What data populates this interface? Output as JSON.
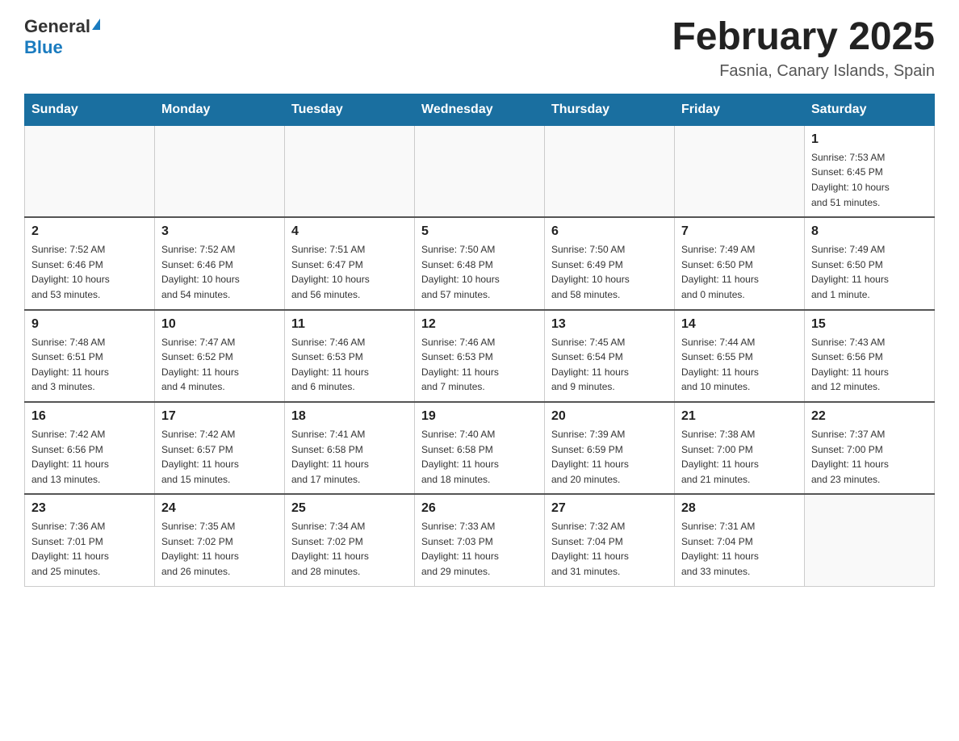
{
  "header": {
    "logo_general": "General",
    "logo_blue": "Blue",
    "title": "February 2025",
    "location": "Fasnia, Canary Islands, Spain"
  },
  "weekdays": [
    "Sunday",
    "Monday",
    "Tuesday",
    "Wednesday",
    "Thursday",
    "Friday",
    "Saturday"
  ],
  "weeks": [
    [
      {
        "day": "",
        "info": ""
      },
      {
        "day": "",
        "info": ""
      },
      {
        "day": "",
        "info": ""
      },
      {
        "day": "",
        "info": ""
      },
      {
        "day": "",
        "info": ""
      },
      {
        "day": "",
        "info": ""
      },
      {
        "day": "1",
        "info": "Sunrise: 7:53 AM\nSunset: 6:45 PM\nDaylight: 10 hours\nand 51 minutes."
      }
    ],
    [
      {
        "day": "2",
        "info": "Sunrise: 7:52 AM\nSunset: 6:46 PM\nDaylight: 10 hours\nand 53 minutes."
      },
      {
        "day": "3",
        "info": "Sunrise: 7:52 AM\nSunset: 6:46 PM\nDaylight: 10 hours\nand 54 minutes."
      },
      {
        "day": "4",
        "info": "Sunrise: 7:51 AM\nSunset: 6:47 PM\nDaylight: 10 hours\nand 56 minutes."
      },
      {
        "day": "5",
        "info": "Sunrise: 7:50 AM\nSunset: 6:48 PM\nDaylight: 10 hours\nand 57 minutes."
      },
      {
        "day": "6",
        "info": "Sunrise: 7:50 AM\nSunset: 6:49 PM\nDaylight: 10 hours\nand 58 minutes."
      },
      {
        "day": "7",
        "info": "Sunrise: 7:49 AM\nSunset: 6:50 PM\nDaylight: 11 hours\nand 0 minutes."
      },
      {
        "day": "8",
        "info": "Sunrise: 7:49 AM\nSunset: 6:50 PM\nDaylight: 11 hours\nand 1 minute."
      }
    ],
    [
      {
        "day": "9",
        "info": "Sunrise: 7:48 AM\nSunset: 6:51 PM\nDaylight: 11 hours\nand 3 minutes."
      },
      {
        "day": "10",
        "info": "Sunrise: 7:47 AM\nSunset: 6:52 PM\nDaylight: 11 hours\nand 4 minutes."
      },
      {
        "day": "11",
        "info": "Sunrise: 7:46 AM\nSunset: 6:53 PM\nDaylight: 11 hours\nand 6 minutes."
      },
      {
        "day": "12",
        "info": "Sunrise: 7:46 AM\nSunset: 6:53 PM\nDaylight: 11 hours\nand 7 minutes."
      },
      {
        "day": "13",
        "info": "Sunrise: 7:45 AM\nSunset: 6:54 PM\nDaylight: 11 hours\nand 9 minutes."
      },
      {
        "day": "14",
        "info": "Sunrise: 7:44 AM\nSunset: 6:55 PM\nDaylight: 11 hours\nand 10 minutes."
      },
      {
        "day": "15",
        "info": "Sunrise: 7:43 AM\nSunset: 6:56 PM\nDaylight: 11 hours\nand 12 minutes."
      }
    ],
    [
      {
        "day": "16",
        "info": "Sunrise: 7:42 AM\nSunset: 6:56 PM\nDaylight: 11 hours\nand 13 minutes."
      },
      {
        "day": "17",
        "info": "Sunrise: 7:42 AM\nSunset: 6:57 PM\nDaylight: 11 hours\nand 15 minutes."
      },
      {
        "day": "18",
        "info": "Sunrise: 7:41 AM\nSunset: 6:58 PM\nDaylight: 11 hours\nand 17 minutes."
      },
      {
        "day": "19",
        "info": "Sunrise: 7:40 AM\nSunset: 6:58 PM\nDaylight: 11 hours\nand 18 minutes."
      },
      {
        "day": "20",
        "info": "Sunrise: 7:39 AM\nSunset: 6:59 PM\nDaylight: 11 hours\nand 20 minutes."
      },
      {
        "day": "21",
        "info": "Sunrise: 7:38 AM\nSunset: 7:00 PM\nDaylight: 11 hours\nand 21 minutes."
      },
      {
        "day": "22",
        "info": "Sunrise: 7:37 AM\nSunset: 7:00 PM\nDaylight: 11 hours\nand 23 minutes."
      }
    ],
    [
      {
        "day": "23",
        "info": "Sunrise: 7:36 AM\nSunset: 7:01 PM\nDaylight: 11 hours\nand 25 minutes."
      },
      {
        "day": "24",
        "info": "Sunrise: 7:35 AM\nSunset: 7:02 PM\nDaylight: 11 hours\nand 26 minutes."
      },
      {
        "day": "25",
        "info": "Sunrise: 7:34 AM\nSunset: 7:02 PM\nDaylight: 11 hours\nand 28 minutes."
      },
      {
        "day": "26",
        "info": "Sunrise: 7:33 AM\nSunset: 7:03 PM\nDaylight: 11 hours\nand 29 minutes."
      },
      {
        "day": "27",
        "info": "Sunrise: 7:32 AM\nSunset: 7:04 PM\nDaylight: 11 hours\nand 31 minutes."
      },
      {
        "day": "28",
        "info": "Sunrise: 7:31 AM\nSunset: 7:04 PM\nDaylight: 11 hours\nand 33 minutes."
      },
      {
        "day": "",
        "info": ""
      }
    ]
  ]
}
